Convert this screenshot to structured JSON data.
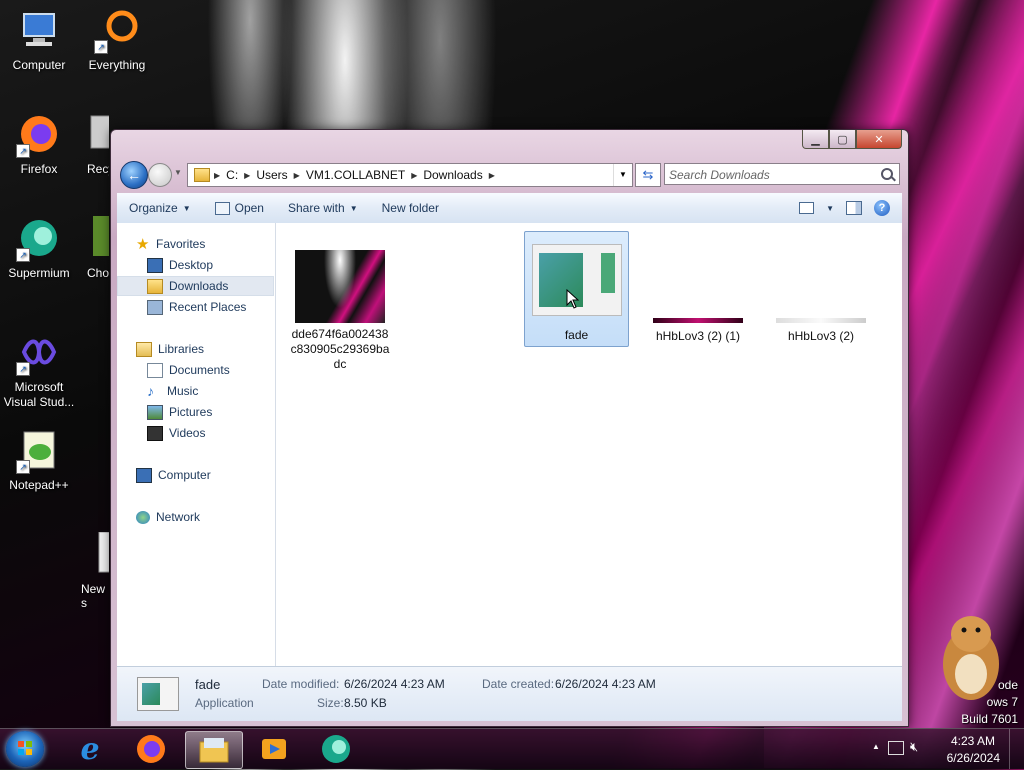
{
  "desktop": {
    "icons": [
      {
        "label": "Computer"
      },
      {
        "label": "Everything"
      },
      {
        "label": "Firefox"
      },
      {
        "label": "Recy"
      },
      {
        "label": "Supermium"
      },
      {
        "label": "Cho"
      },
      {
        "label": "Microsoft Visual Stud..."
      },
      {
        "label": "Notepad++"
      },
      {
        "label": "New s"
      }
    ],
    "watermark": [
      "ode",
      "ows 7",
      "Build 7601"
    ]
  },
  "window": {
    "address": {
      "segments": [
        "C:",
        "Users",
        "VM1.COLLABNET",
        "Downloads"
      ]
    },
    "search": {
      "placeholder": "Search Downloads"
    },
    "toolbar": {
      "organize": "Organize",
      "open": "Open",
      "share_with": "Share with",
      "new_folder": "New folder"
    },
    "nav": {
      "favorites": "Favorites",
      "desktop": "Desktop",
      "downloads": "Downloads",
      "recent_places": "Recent Places",
      "libraries": "Libraries",
      "documents": "Documents",
      "music": "Music",
      "pictures": "Pictures",
      "videos": "Videos",
      "computer": "Computer",
      "network": "Network"
    },
    "files": [
      {
        "name_line1": "dde674f6a002438",
        "name_line2": "c830905c29369ba",
        "name_line3": "dc"
      },
      {
        "name": "fade"
      },
      {
        "name": "hHbLov3 (2) (1)"
      },
      {
        "name": "hHbLov3 (2)"
      }
    ],
    "details": {
      "name": "fade",
      "type": "Application",
      "date_modified_label": "Date modified:",
      "date_modified": "6/26/2024 4:23 AM",
      "date_created_label": "Date created:",
      "date_created": "6/26/2024 4:23 AM",
      "size_label": "Size:",
      "size": "8.50 KB"
    }
  },
  "taskbar": {
    "time": "4:23 AM",
    "date": "6/26/2024"
  },
  "colors": {
    "accent_pink": "#e0148f",
    "selection": "#c5def8"
  }
}
